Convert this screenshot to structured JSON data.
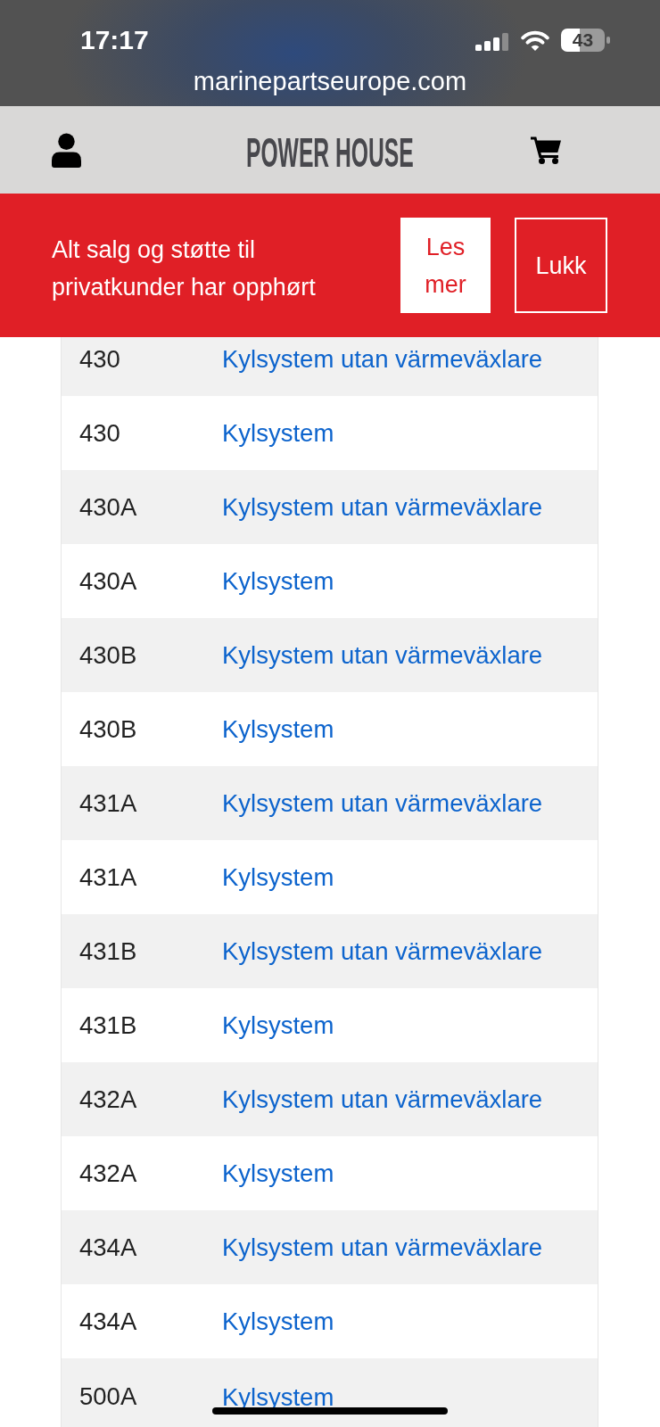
{
  "status_bar": {
    "time": "17:17",
    "battery": "43",
    "url": "marinepartseurope.com"
  },
  "header": {
    "logo": "POWER HOUSE"
  },
  "notice": {
    "message": "Alt salg og støtte til privatkunder har opphørt",
    "buttons": [
      {
        "label": "Les mer",
        "kind": "filled"
      },
      {
        "label": "Lukk",
        "kind": "outline"
      }
    ]
  },
  "table": {
    "rows": [
      {
        "code": "430",
        "link": "Kylsystem utan värmeväxlare"
      },
      {
        "code": "430",
        "link": "Kylsystem"
      },
      {
        "code": "430A",
        "link": "Kylsystem utan värmeväxlare"
      },
      {
        "code": "430A",
        "link": "Kylsystem"
      },
      {
        "code": "430B",
        "link": "Kylsystem utan värmeväxlare"
      },
      {
        "code": "430B",
        "link": "Kylsystem"
      },
      {
        "code": "431A",
        "link": "Kylsystem utan värmeväxlare"
      },
      {
        "code": "431A",
        "link": "Kylsystem"
      },
      {
        "code": "431B",
        "link": "Kylsystem utan värmeväxlare"
      },
      {
        "code": "431B",
        "link": "Kylsystem"
      },
      {
        "code": "432A",
        "link": "Kylsystem utan värmeväxlare"
      },
      {
        "code": "432A",
        "link": "Kylsystem"
      },
      {
        "code": "434A",
        "link": "Kylsystem utan värmeväxlare"
      },
      {
        "code": "434A",
        "link": "Kylsystem"
      },
      {
        "code": "500A",
        "link": "Kylsystem"
      }
    ]
  }
}
